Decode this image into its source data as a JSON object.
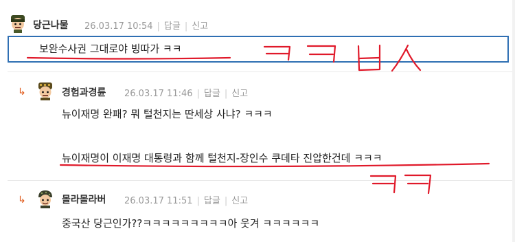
{
  "comments": [
    {
      "author": "당근나물",
      "date": "26.03.17 10:54",
      "reply_label": "답글",
      "report_label": "신고",
      "text": "보완수사권 그대로야 빙따가 ㅋㅋ"
    },
    {
      "author": "경험과경륜",
      "date": "26.03.17 11:46",
      "reply_label": "답글",
      "report_label": "신고",
      "text_line1": "뉴이재명 완패? 뭐 털천지는 딴세상 사냐? ㅋㅋㅋ",
      "text_line2": "뉴이재명이 이재명 대통령과 함께 털천지-장인수 쿠데타 진압한건데 ㅋㅋㅋ"
    },
    {
      "author": "몰라몰라버",
      "date": "26.03.17 11:51",
      "reply_label": "답글",
      "report_label": "신고",
      "text": "중국산 당근인가??ㅋㅋㅋㅋㅋㅋㅋㅋㅋ아 웃겨 ㅋㅋㅋㅋㅋㅋ"
    }
  ],
  "colors": {
    "annotation_red": "#e0192a",
    "highlight_blue": "#2f6fb3",
    "reply_arrow": "#e05a1a"
  },
  "icons": [
    "reply-arrow-icon",
    "avatar-icon"
  ]
}
